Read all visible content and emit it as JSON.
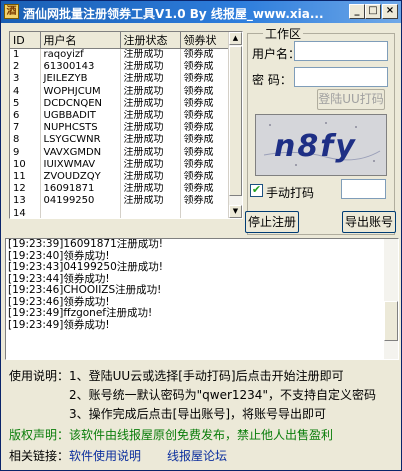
{
  "window": {
    "title": "酒仙网批量注册领券工具V1.0  By 线报屋_www.xia...",
    "min_label": "_",
    "max_label": "□",
    "close_label": "×"
  },
  "grid": {
    "columns": [
      "ID",
      "用户名",
      "注册状态",
      "领券状"
    ],
    "rows": [
      [
        "1",
        "raqoyizf",
        "注册成功",
        "领券成"
      ],
      [
        "2",
        "61300143",
        "注册成功",
        "领券成"
      ],
      [
        "3",
        "JEILEZYB",
        "注册成功",
        "领券成"
      ],
      [
        "4",
        "WOPHJCUM",
        "注册成功",
        "领券成"
      ],
      [
        "5",
        "DCDCNQEN",
        "注册成功",
        "领券成"
      ],
      [
        "6",
        "UGBBADIT",
        "注册成功",
        "领券成"
      ],
      [
        "7",
        "NUPHCSTS",
        "注册成功",
        "领券成"
      ],
      [
        "8",
        "LSYGCWNR",
        "注册成功",
        "领券成"
      ],
      [
        "9",
        "VAVXGMDN",
        "注册成功",
        "领券成"
      ],
      [
        "10",
        "IUIXWMAV",
        "注册成功",
        "领券成"
      ],
      [
        "11",
        "ZVOUDZQY",
        "注册成功",
        "领券成"
      ],
      [
        "12",
        "16091871",
        "注册成功",
        "领券成"
      ],
      [
        "13",
        "04199250",
        "注册成功",
        "领券成"
      ],
      [
        "14",
        "",
        "",
        ""
      ]
    ]
  },
  "work_area": {
    "legend": "工作区",
    "username_label": "用户名：",
    "username_value": "",
    "password_label": "密  码：",
    "password_value": "",
    "login_button": "登陆UU打码",
    "captcha_text": "n8fy",
    "manual_label": "手动打码",
    "manual_checked": true,
    "manual_value": "",
    "stop_button": "停止注册",
    "export_button": "导出账号"
  },
  "log": {
    "lines": [
      "[19:23:39]16091871注册成功!",
      "[19:23:40]领券成功!",
      "[19:23:43]04199250注册成功!",
      "[19:23:44]领券成功!",
      "[19:23:46]CHOOIIZS注册成功!",
      "[19:23:46]领券成功!",
      "[19:23:49]ffzgonef注册成功!",
      "[19:23:49]领券成功!"
    ]
  },
  "instructions": {
    "title": "使用说明：",
    "line1": "1、登陆UU云或选择[手动打码]后点击开始注册即可",
    "line2": "2、账号统一默认密码为\"qwer1234\"，不支持自定义密码",
    "line3": "3、操作完成后点击[导出账号]，将账号导出即可"
  },
  "copyright": {
    "label": "版权声明：",
    "text": "该软件由线报屋原创免费发布，禁止他人出售盈利"
  },
  "links": {
    "label": "相关链接：",
    "link1": "软件使用说明",
    "link2": "线报屋论坛"
  },
  "colors": {
    "title_bar": "#1a5fb4",
    "green_text": "#0a7d0a",
    "link_blue": "#0c2f9e"
  }
}
